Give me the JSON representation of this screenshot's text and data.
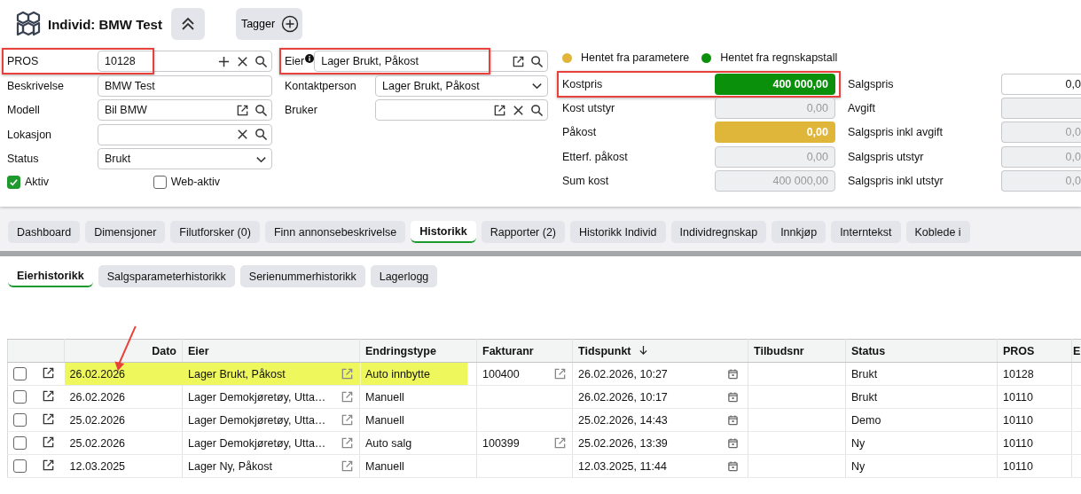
{
  "header": {
    "title": "Individ: BMW Test",
    "tags_label": "Tagger"
  },
  "left_fields": [
    {
      "label": "PROS",
      "value": "10128",
      "kind": "lookup",
      "add": true,
      "clear": true,
      "search": true,
      "highlighted": true
    },
    {
      "label": "Beskrivelse",
      "value": "BMW Test",
      "kind": "text",
      "highlighted": false
    },
    {
      "label": "Modell",
      "value": "Bil BMW",
      "kind": "lookup",
      "open": true,
      "search": true,
      "highlighted": false
    },
    {
      "label": "Lokasjon",
      "kind": "lookup",
      "clear": true,
      "search": true,
      "highlighted": false
    },
    {
      "label": "Status",
      "value": "Brukt",
      "kind": "dropdown",
      "highlighted": false
    }
  ],
  "checkboxes": [
    {
      "label": "Aktiv",
      "checked": true
    },
    {
      "label": "Web-aktiv",
      "checked": false
    }
  ],
  "middle_fields": [
    {
      "label": "Eier",
      "info": true,
      "value": "Lager Brukt, Påkost",
      "kind": "lookup",
      "open": true,
      "search": true,
      "highlighted": true
    },
    {
      "label": "Kontaktperson",
      "info": false,
      "value": "Lager Brukt, Påkost",
      "kind": "dropdown",
      "highlighted": false
    },
    {
      "label": "Bruker",
      "info": false,
      "kind": "lookup",
      "open": true,
      "clear": true,
      "search": true,
      "highlighted": false
    }
  ],
  "legend": [
    {
      "label": "Hentet fra parametere",
      "color": "#e0b63a"
    },
    {
      "label": "Hentet fra regnskapstall",
      "color": "#0b900b"
    }
  ],
  "cost_fields": [
    {
      "label": "Kostpris",
      "value": "400 000,00",
      "color": "#0b900b",
      "disabled": false,
      "highlighted": true
    },
    {
      "label": "Kost utstyr",
      "value": "0,00",
      "disabled": true,
      "highlighted": false
    },
    {
      "label": "Påkost",
      "value": "0,00",
      "color": "#e0b63a",
      "disabled": false,
      "highlighted": false
    },
    {
      "label": "Etterf. påkost",
      "value": "0,00",
      "disabled": true,
      "highlighted": false
    },
    {
      "label": "Sum kost",
      "value": "400 000,00",
      "disabled": true,
      "highlighted": false
    }
  ],
  "sales_fields": [
    {
      "label": "Salgspris",
      "value": "0,0",
      "disabled": false
    },
    {
      "label": "Avgift",
      "disabled": true
    },
    {
      "label": "Salgspris inkl avgift",
      "value": "0,0",
      "disabled": true
    },
    {
      "label": "Salgspris utstyr",
      "value": "0,0",
      "disabled": true
    },
    {
      "label": "Salgspris inkl utstyr",
      "value": "0,0",
      "disabled": true
    }
  ],
  "tabs": [
    {
      "label": "Dashboard",
      "selected": false
    },
    {
      "label": "Dimensjoner",
      "selected": false
    },
    {
      "label": "Filutforsker (0)",
      "selected": false
    },
    {
      "label": "Finn annonsebeskrivelse",
      "selected": false
    },
    {
      "label": "Historikk",
      "selected": true
    },
    {
      "label": "Rapporter (2)",
      "selected": false
    },
    {
      "label": "Historikk Individ",
      "selected": false
    },
    {
      "label": "Individregnskap",
      "selected": false
    },
    {
      "label": "Innkjøp",
      "selected": false
    },
    {
      "label": "Interntekst",
      "selected": false
    },
    {
      "label": "Koblede i",
      "selected": false
    }
  ],
  "sub_tabs": [
    {
      "label": "Eierhistorikk",
      "selected": true
    },
    {
      "label": "Salgsparameterhistorikk",
      "selected": false
    },
    {
      "label": "Serienummerhistorikk",
      "selected": false
    },
    {
      "label": "Lagerlogg",
      "selected": false
    }
  ],
  "table": {
    "columns": [
      {
        "label": "Dato"
      },
      {
        "label": "Eier"
      },
      {
        "label": "Endringstype"
      },
      {
        "label": "Fakturanr"
      },
      {
        "label": "Tidspunkt",
        "sort_descending": true
      },
      {
        "label": "Tilbudsnr"
      },
      {
        "label": "Status"
      },
      {
        "label": "PROS"
      },
      {
        "label": "E"
      }
    ],
    "rows": [
      {
        "checked": false,
        "highlighted": true,
        "dato": "26.02.2026",
        "eier": "Lager Brukt, Påkost",
        "endringstype": "Auto innbytte",
        "fakturanr": "100400",
        "tidspunkt": "26.02.2026, 10:27",
        "status": "Brukt",
        "pros": "10128"
      },
      {
        "checked": false,
        "highlighted": false,
        "dato": "26.02.2026",
        "eier": "Lager Demokjøretøy, Utta…",
        "endringstype": "Manuell",
        "tidspunkt": "26.02.2026, 10:17",
        "status": "Brukt",
        "pros": "10110"
      },
      {
        "checked": false,
        "highlighted": false,
        "dato": "25.02.2026",
        "eier": "Lager Demokjøretøy, Utta…",
        "endringstype": "Manuell",
        "tidspunkt": "25.02.2026, 14:43",
        "status": "Demo",
        "pros": "10110"
      },
      {
        "checked": false,
        "highlighted": false,
        "dato": "25.02.2026",
        "eier": "Lager Demokjøretøy, Utta…",
        "endringstype": "Auto salg",
        "fakturanr": "100399",
        "tidspunkt": "25.02.2026, 13:39",
        "status": "Ny",
        "pros": "10110"
      },
      {
        "checked": false,
        "highlighted": false,
        "dato": "12.03.2025",
        "eier": "Lager Ny, Påkost",
        "endringstype": "Manuell",
        "tidspunkt": "12.03.2025, 11:44",
        "status": "Ny",
        "pros": "10110"
      }
    ]
  },
  "annotation_arrow": true
}
